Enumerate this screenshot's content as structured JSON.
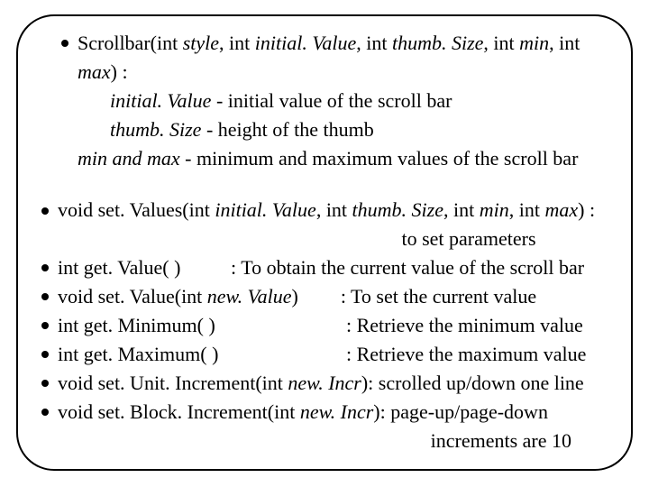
{
  "top": {
    "ctor_prefix": "Scrollbar(int ",
    "ctor_p_style": "style",
    "ctor_s1": ", int ",
    "ctor_p_iv": "initial. Value",
    "ctor_s2": ", int ",
    "ctor_p_ts": "thumb. Size",
    "ctor_s3": ", int ",
    "ctor_p_min": "min",
    "ctor_s4": ", int ",
    "ctor_p_max": "max",
    "ctor_suffix": ") :",
    "desc_iv_name": "initial. Value",
    "desc_iv_text": " - initial value of the scroll bar",
    "desc_ts_name": "thumb. Size",
    "desc_ts_text": " - height of the thumb",
    "desc_mm_name": "min and max ",
    "desc_mm_text": " - minimum and maximum values of the scroll bar"
  },
  "items": {
    "b1_pre": "void set. Values(int ",
    "b1_p1": "initial. Value",
    "b1_s1": ", int ",
    "b1_p2": "thumb. Size",
    "b1_s2": ", int ",
    "b1_p3": "min",
    "b1_s3": ", int ",
    "b1_p4": "max",
    "b1_post": ") :",
    "b1_trail": "to set parameters",
    "b2_pre": "int get. Value( )",
    "b2_desc": ": To obtain the current value of the scroll bar",
    "b3_pre": "void set. Value(int ",
    "b3_p": "new. Value",
    "b3_post": ")",
    "b3_desc": ": To set the current value",
    "b4_pre": "int get. Minimum( )",
    "b4_desc": ": Retrieve the minimum value",
    "b5_pre": "int get. Maximum( )",
    "b5_desc": ": Retrieve the maximum value",
    "b6_pre": "void set. Unit. Increment(int ",
    "b6_p": "new. Incr",
    "b6_post": "): scrolled up/down one line",
    "b7_pre": "void set. Block. Increment(int  ",
    "b7_p": "new. Incr",
    "b7_post": "): page-up/page-down",
    "b7_trail": "increments are 10"
  }
}
